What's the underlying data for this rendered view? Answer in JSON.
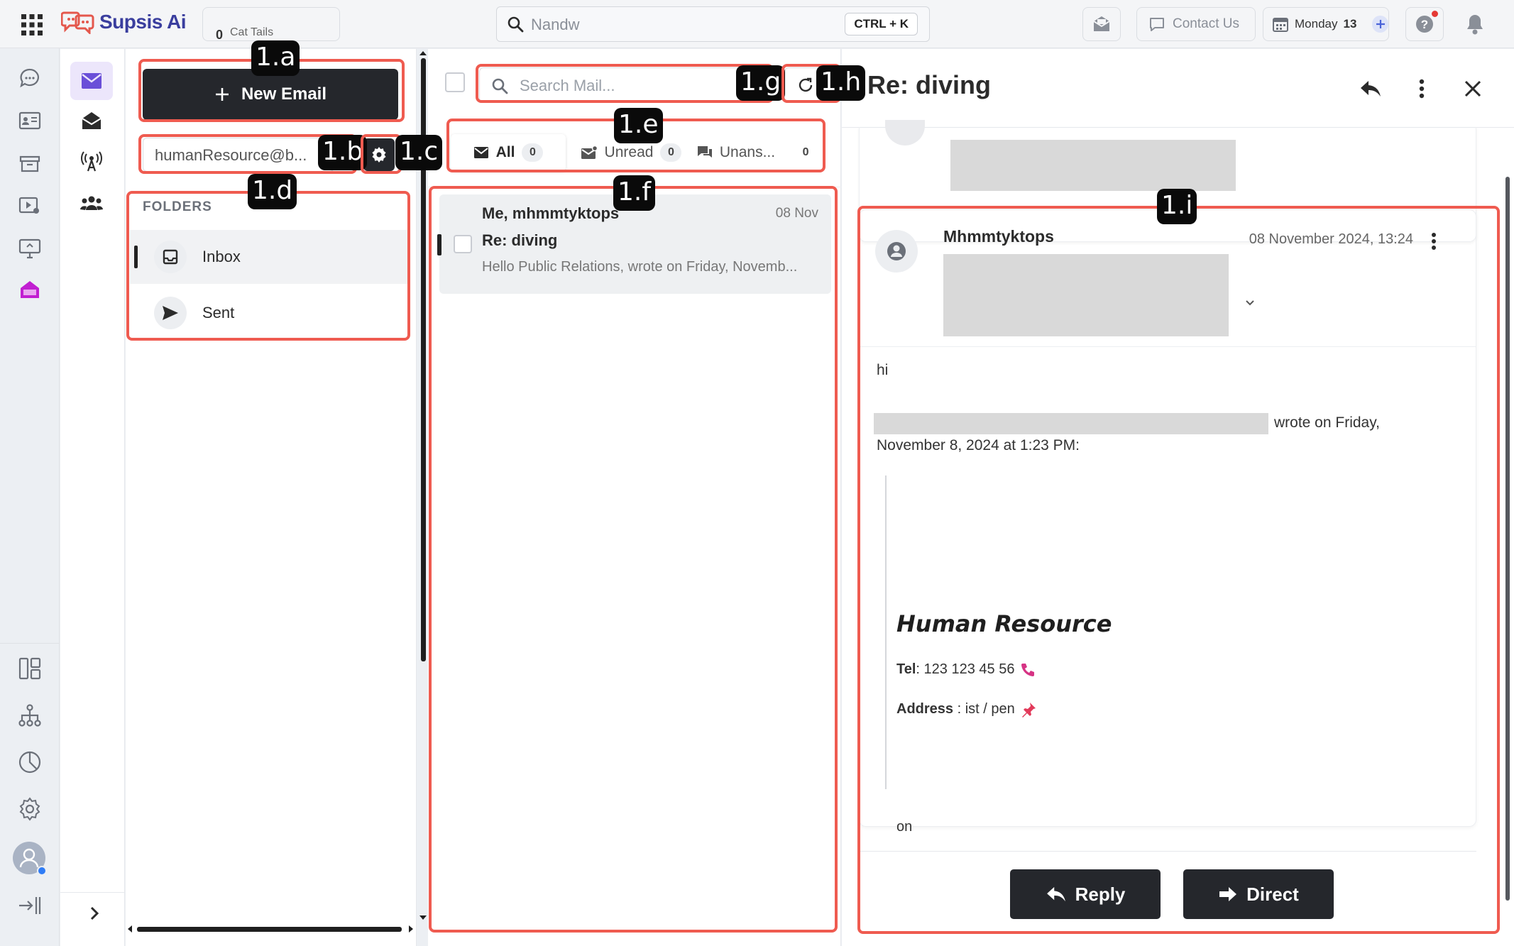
{
  "brand": {
    "name": "Supsis Ai"
  },
  "topbar": {
    "cat_count": "0",
    "cat_label": "Cat Tails",
    "search_value": "Nandw",
    "shortcut": "CTRL + K",
    "contact_label": "Contact Us",
    "day_label": "Monday",
    "day_number": "13"
  },
  "folder_panel": {
    "new_email_label": "New Email",
    "account": "humanResource@b...",
    "folders_title": "FOLDERS",
    "folders": [
      {
        "label": "Inbox",
        "icon": "inbox-icon",
        "active": true
      },
      {
        "label": "Sent",
        "icon": "send-icon",
        "active": false
      }
    ]
  },
  "mail_list": {
    "search_placeholder": "Search Mail...",
    "tabs": [
      {
        "label": "All",
        "count": "0",
        "icon": "mail-icon"
      },
      {
        "label": "Unread",
        "count": "0",
        "icon": "unread-mail-icon"
      },
      {
        "label": "Unans...",
        "count": "0",
        "icon": "chat-icon"
      }
    ],
    "rows": [
      {
        "from": "Me, mhmmtyktops",
        "date": "08 Nov",
        "subject": "Re: diving",
        "snippet": "Hello Public Relations, wrote on Friday, Novemb..."
      }
    ]
  },
  "reader": {
    "title": "Re: diving",
    "message": {
      "from": "Mhmmtyktops",
      "date": "08 November 2024, 13:24",
      "body_greeting": "hi",
      "wrote_suffix": "wrote on Friday,",
      "wrote_date": "November 8, 2024 at 1:23 PM:",
      "signature_name": "Human Resource",
      "tel_label": "Tel",
      "tel_value": ": 123 123 45 56",
      "address_label": "Address",
      "address_value": " : ist / pen",
      "closing": "on"
    },
    "reply_label": "Reply",
    "direct_label": "Direct"
  },
  "annotations": [
    "1.a",
    "1.b",
    "1.c",
    "1.d",
    "1.e",
    "1.f",
    "1.g",
    "1.h",
    "1.i"
  ],
  "colors": {
    "accent": "#3a3e9e",
    "active_nav": "#6a4fd8",
    "highlight": "#ef5b50",
    "dark_button": "#25272c",
    "tel_icon": "#d63384"
  }
}
